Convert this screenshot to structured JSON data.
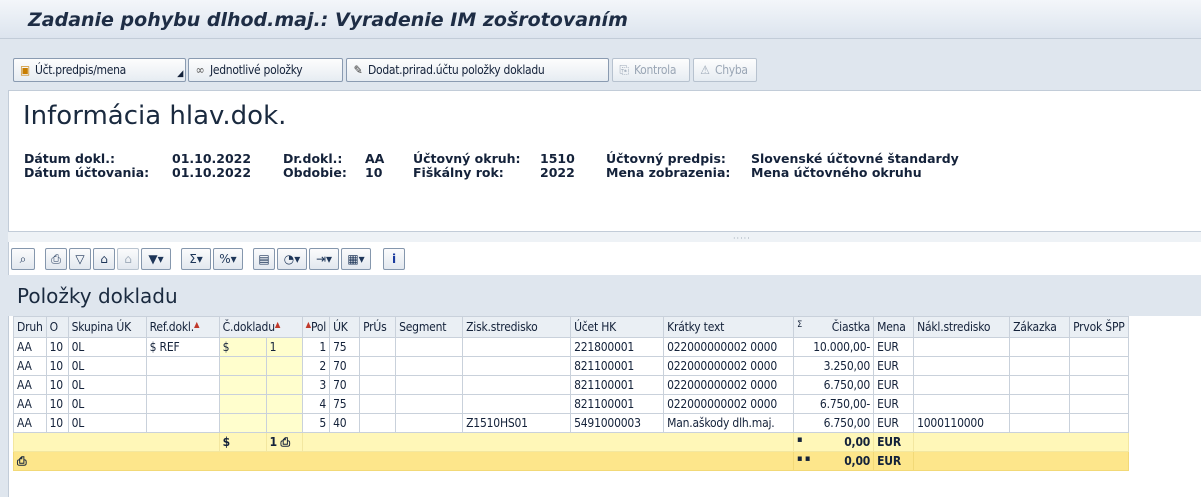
{
  "window": {
    "title": "Zadanie pohybu dlhod.maj.: Vyradenie IM zošrotovaním"
  },
  "app_toolbar": {
    "btn_ledger": "Účt.predpis/mena",
    "btn_items": "Jednotlivé položky",
    "btn_acct": "Dodat.prirad.účtu položky dokladu",
    "btn_check": "Kontrola",
    "btn_error": "Chyba"
  },
  "header_info": {
    "title": "Informácia hlav.dok.",
    "doc_date_label": "Dátum dokl.:",
    "doc_date": "01.10.2022",
    "post_date_label": "Dátum účtovania:",
    "post_date": "01.10.2022",
    "doc_type_label": "Dr.dokl.:",
    "doc_type": "AA",
    "period_label": "Obdobie:",
    "period": "10",
    "company_label": "Účtovný okruh:",
    "company": "1510",
    "fiscal_year_label": "Fiškálny rok:",
    "fiscal_year": "2022",
    "ledger_label": "Účtovný predpis:",
    "ledger": "Slovenské účtovné štandardy",
    "currency_view_label": "Mena zobrazenia:",
    "currency_view": "Mena účtovného okruhu"
  },
  "grid": {
    "title": "Položky dokladu",
    "headers": [
      "Druh",
      "O",
      "Skupina ÚK",
      "Ref.dokl.",
      "Č.dokladu",
      "Pol",
      "ÚK",
      "PrÚs",
      "Segment",
      "Zisk.stredisko",
      "Účet HK",
      "Krátky text",
      "Čiastka",
      "Mena",
      "Nákl.stredisko",
      "Zákazka",
      "Prvok ŠPP"
    ],
    "rows": [
      [
        "AA",
        "10",
        "0L",
        "$ REF",
        "$",
        "1",
        "1",
        "75",
        "",
        "",
        "",
        "221800001",
        "022000000002 0000",
        "10.000,00-",
        "EUR",
        "",
        "",
        ""
      ],
      [
        "AA",
        "10",
        "0L",
        "",
        "",
        "",
        "2",
        "70",
        "",
        "",
        "",
        "821100001",
        "022000000002 0000",
        "3.250,00",
        "EUR",
        "",
        "",
        ""
      ],
      [
        "AA",
        "10",
        "0L",
        "",
        "",
        "",
        "3",
        "70",
        "",
        "",
        "",
        "821100001",
        "022000000002 0000",
        "6.750,00",
        "EUR",
        "",
        "",
        ""
      ],
      [
        "AA",
        "10",
        "0L",
        "",
        "",
        "",
        "4",
        "75",
        "",
        "",
        "",
        "821100001",
        "022000000002 0000",
        "6.750,00-",
        "EUR",
        "",
        "",
        ""
      ],
      [
        "AA",
        "10",
        "0L",
        "",
        "",
        "",
        "5",
        "40",
        "",
        "",
        "Z1510HS01",
        "5491000003",
        "Man.aškody dlh.maj.",
        "6.750,00",
        "EUR",
        "1000110000",
        "",
        ""
      ]
    ],
    "subtotal": {
      "doc_prefix": "$",
      "doc_no": "1",
      "marker": "▪",
      "amount": "0,00",
      "currency": "EUR"
    },
    "total": {
      "marker": "▪ ▪",
      "amount": "0,00",
      "currency": "EUR"
    }
  },
  "colors": {
    "sum_row": "#fff7b8",
    "total_row": "#fde68b",
    "key_cells": "#fffecd"
  }
}
